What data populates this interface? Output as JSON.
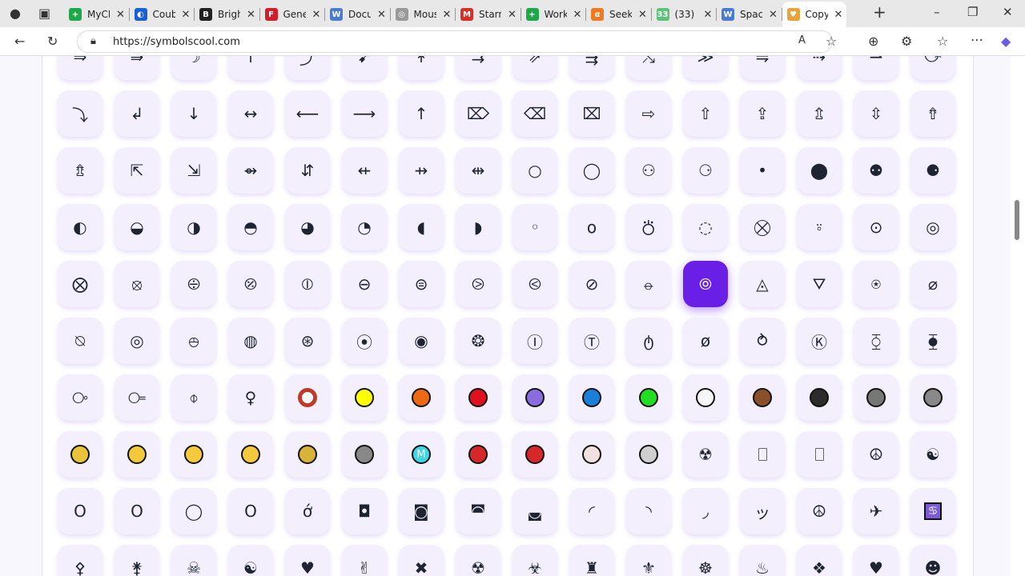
{
  "browser": {
    "tabs": [
      {
        "title": "MyCF",
        "color": "#1fa84a",
        "glyph": "+"
      },
      {
        "title": "Coub",
        "color": "#1a5fd6",
        "glyph": "◐"
      },
      {
        "title": "Brigh",
        "color": "#222",
        "glyph": "B"
      },
      {
        "title": "Gene",
        "color": "#d01f2a",
        "glyph": "F"
      },
      {
        "title": "Docu",
        "color": "#4a7bd0",
        "glyph": "W"
      },
      {
        "title": "Mous",
        "color": "#999",
        "glyph": "◎"
      },
      {
        "title": "Starr",
        "color": "#d93025",
        "glyph": "M"
      },
      {
        "title": "Work",
        "color": "#1fa84a",
        "glyph": "+"
      },
      {
        "title": "Seek",
        "color": "#f07a21",
        "glyph": "α"
      },
      {
        "title": "(33) \\",
        "color": "#5cc27a",
        "glyph": "33"
      },
      {
        "title": "Spac",
        "color": "#4a7bd0",
        "glyph": "W"
      },
      {
        "title": "Copy",
        "color": "#e8a33a",
        "glyph": "♥"
      }
    ],
    "url": "https://symbolscool.com"
  },
  "symbols": [
    [
      "⇒",
      "⇛",
      "☽",
      "↑",
      "⤴",
      "➹",
      "↟",
      "⇉",
      "⇗",
      "⇶",
      "⤭",
      "≫",
      "⇋",
      "⇢",
      "⇀",
      "⤻"
    ],
    [
      "⤵",
      "↲",
      "↓",
      "↔",
      "⟵",
      "⟶",
      "↑",
      "⌦",
      "⌫",
      "⌧",
      "⇨",
      "⇧",
      "⇪",
      "⇬",
      "⇳",
      "⇮"
    ],
    [
      "⇯",
      "⇱",
      "⇲",
      "⇴",
      "⇵",
      "⇷",
      "⇸",
      "⇹",
      "○",
      "◯",
      "⚇",
      "⚆",
      "•",
      "⬤",
      "⚉",
      "⚈"
    ],
    [
      "◐",
      "◒",
      "◑",
      "◓",
      "◕",
      "◔",
      "◖",
      "◗",
      "◦",
      "ο",
      "⛣",
      "◌",
      "⛒",
      "⍤",
      "⊙",
      "◎"
    ],
    [
      "⨂",
      "⦻",
      "⨸",
      "⦼",
      "⦶",
      "⊖",
      "⊜",
      "⧁",
      "⧀",
      "⊘",
      "⦵",
      "⦾",
      "◬",
      "⛛",
      "⍟",
      "⌀"
    ],
    [
      "⍉",
      "◎",
      "⦺",
      "◍",
      "⊛",
      "⦿",
      "◉",
      "❂",
      "Ⓘ",
      "Ⓣ",
      "ტ",
      "ø",
      "⥁",
      "Ⓚ",
      "⧲",
      "⧳"
    ],
    [
      "⧂",
      "⧃",
      "⌽",
      "♀",
      "⭕",
      "🟡",
      "🟠",
      "🔴",
      "🟣",
      "🔵",
      "🟢",
      "⚪",
      "🟤",
      "⚫",
      "🌑",
      "🌒"
    ],
    [
      "🌓",
      "🌔",
      "🌕",
      "🌖",
      "🌗",
      "🌘",
      "Ⓜ",
      "🎯",
      "⛔",
      "🚫",
      "🔘",
      "☢",
      "📱",
      "📲",
      "☮",
      "☯"
    ],
    [
      "O",
      "O",
      "◯",
      "O",
      "ớ",
      "◘",
      "◙",
      "◚",
      "◛",
      "◜",
      "◝",
      "◞",
      "ッ",
      "☮",
      "✈",
      "♋"
    ],
    [
      "⚴",
      "⚵",
      "☠",
      "☯",
      "♥",
      "✌",
      "✖",
      "☢",
      "☣",
      "♜",
      "⚜",
      "☸",
      "♨",
      "❖",
      "♥",
      "☻"
    ]
  ],
  "colored": {
    "⭕": "#c0392b",
    "🟡": "#ffff00",
    "🟠": "#ee6a12",
    "🔴": "#e0101e",
    "🟣": "#8b6be0",
    "🔵": "#1a7fd8",
    "🟢": "#22dd22",
    "⚪": "#f7f7f7",
    "🟤": "#8b4f2a",
    "⚫": "#2c2c2c",
    "🌑": "#777",
    "🌒": "#888",
    "🌓": "#e9c43a",
    "🌔": "#f2c93b",
    "🌕": "#f5c93c",
    "🌖": "#f2c93b",
    "🌗": "#d9b23a",
    "🌘": "#888",
    "Ⓜ": "#3fd6e6",
    "🎯": "#d62828",
    "⛔": "#d62828",
    "🚫": "#f0e0e0",
    "🔘": "#cfcfcf"
  },
  "highlighted": "⦾",
  "accent": "#6a1fe6"
}
